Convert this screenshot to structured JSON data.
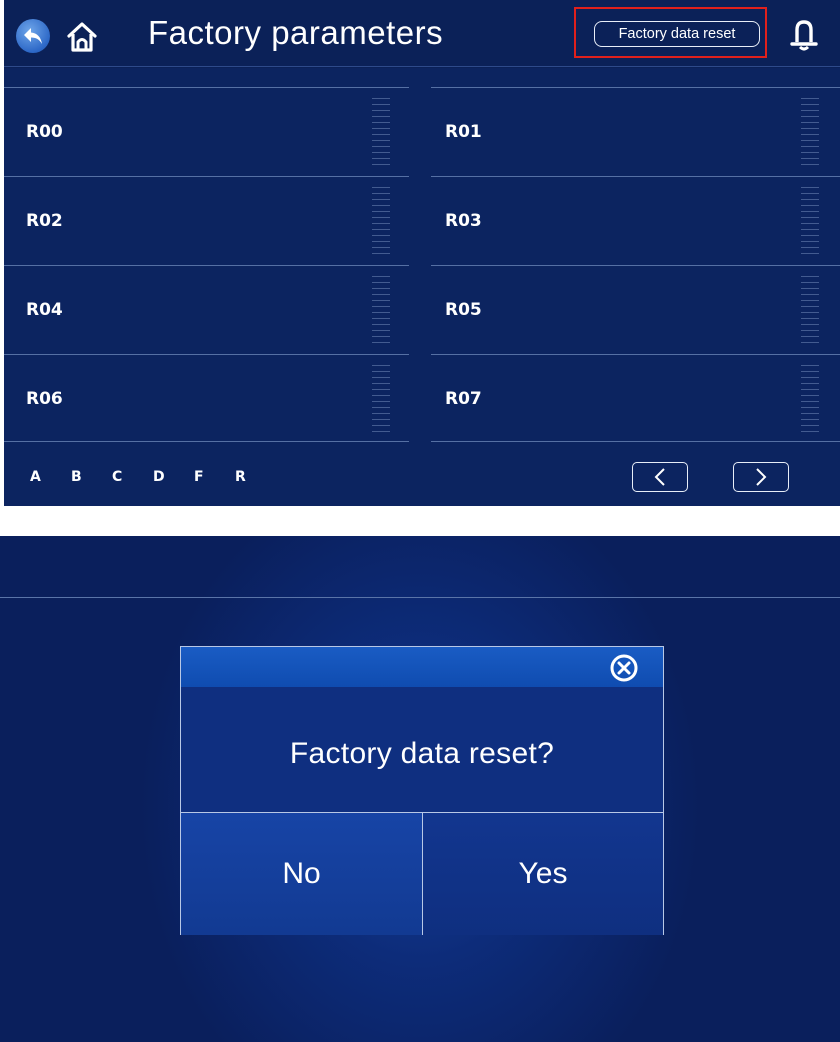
{
  "header": {
    "title": "Factory parameters",
    "reset_button_label": "Factory data reset",
    "highlight_color": "#e0201c",
    "icons": {
      "back": "back-arrow-icon",
      "home": "home-icon",
      "bell": "bell-icon"
    }
  },
  "parameters": [
    {
      "code": "R00"
    },
    {
      "code": "R01"
    },
    {
      "code": "R02"
    },
    {
      "code": "R03"
    },
    {
      "code": "R04"
    },
    {
      "code": "R05"
    },
    {
      "code": "R06"
    },
    {
      "code": "R07"
    }
  ],
  "alpha_index": [
    "A",
    "B",
    "C",
    "D",
    "F",
    "R"
  ],
  "pagination": {
    "prev_icon": "chevron-left-icon",
    "next_icon": "chevron-right-icon"
  },
  "dialog": {
    "message": "Factory data reset?",
    "no_label": "No",
    "yes_label": "Yes",
    "close_icon": "close-circle-icon"
  },
  "colors": {
    "background": "#0c2460",
    "dialog_header": "#1a5cc4",
    "text": "#ffffff"
  }
}
